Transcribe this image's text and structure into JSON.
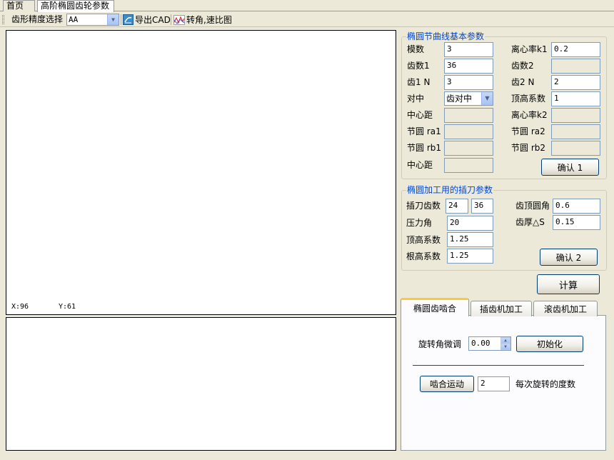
{
  "doc_tabs": [
    "首页",
    "高阶椭圆齿轮参数"
  ],
  "toolbar": {
    "precision_label": "齿形精度选择",
    "precision_value": "AA",
    "export_cad_label": "导出CAD",
    "ratio_chart_label": "转角,速比图"
  },
  "canvas": {
    "x_readout": "X:96",
    "y_readout": "Y:61"
  },
  "pitch_group": {
    "title": "椭圆节曲线基本参数",
    "module_label": "模数",
    "module_value": "3",
    "ecc_k1_label": "离心率k1",
    "ecc_k1_value": "0.2",
    "teeth1_label": "齿数1",
    "teeth1_value": "36",
    "teeth2_label": "齿数2",
    "teeth2_value": "",
    "z1n_label": "齿1 N",
    "z1n_value": "3",
    "z2n_label": "齿2 N",
    "z2n_value": "2",
    "align_label": "对中",
    "align_value": "齿对中",
    "addendum_label": "顶高系数",
    "addendum_value": "1",
    "center_dist_label": "中心距",
    "center_dist_value": "",
    "ecc_k2_label": "离心率k2",
    "ecc_k2_value": "",
    "ra1_label": "节圆 ra1",
    "ra1_value": "",
    "ra2_label": "节圆 ra2",
    "ra2_value": "",
    "rb1_label": "节圆 rb1",
    "rb1_value": "",
    "rb2_label": "节圆 rb2",
    "rb2_value": "",
    "center_dist2_label": "中心距",
    "center_dist2_value": "",
    "confirm_label": "确认 1"
  },
  "cutter_group": {
    "title": "椭圆加工用的插刀参数",
    "cutter_teeth_label": "插刀齿数",
    "cutter_teeth_a": "24",
    "cutter_teeth_b": "36",
    "tip_round_label": "齿顶圆角",
    "tip_round_value": "0.6",
    "pressure_label": "压力角",
    "pressure_value": "20",
    "thickness_label": "齿厚△S",
    "thickness_value": "0.15",
    "addendum_label": "顶高系数",
    "addendum_value": "1.25",
    "dedendum_label": "根高系数",
    "dedendum_value": "1.25",
    "confirm_label": "确认 2"
  },
  "compute_label": "计算",
  "tabs": [
    "椭圆齿啮合",
    "插齿机加工",
    "滚齿机加工"
  ],
  "mesh_tab": {
    "rotate_label": "旋转角微调",
    "rotate_value": "0.00",
    "init_label": "初始化",
    "motion_label": "啮合运动",
    "step_value": "2",
    "step_label": "每次旋转的度数"
  }
}
